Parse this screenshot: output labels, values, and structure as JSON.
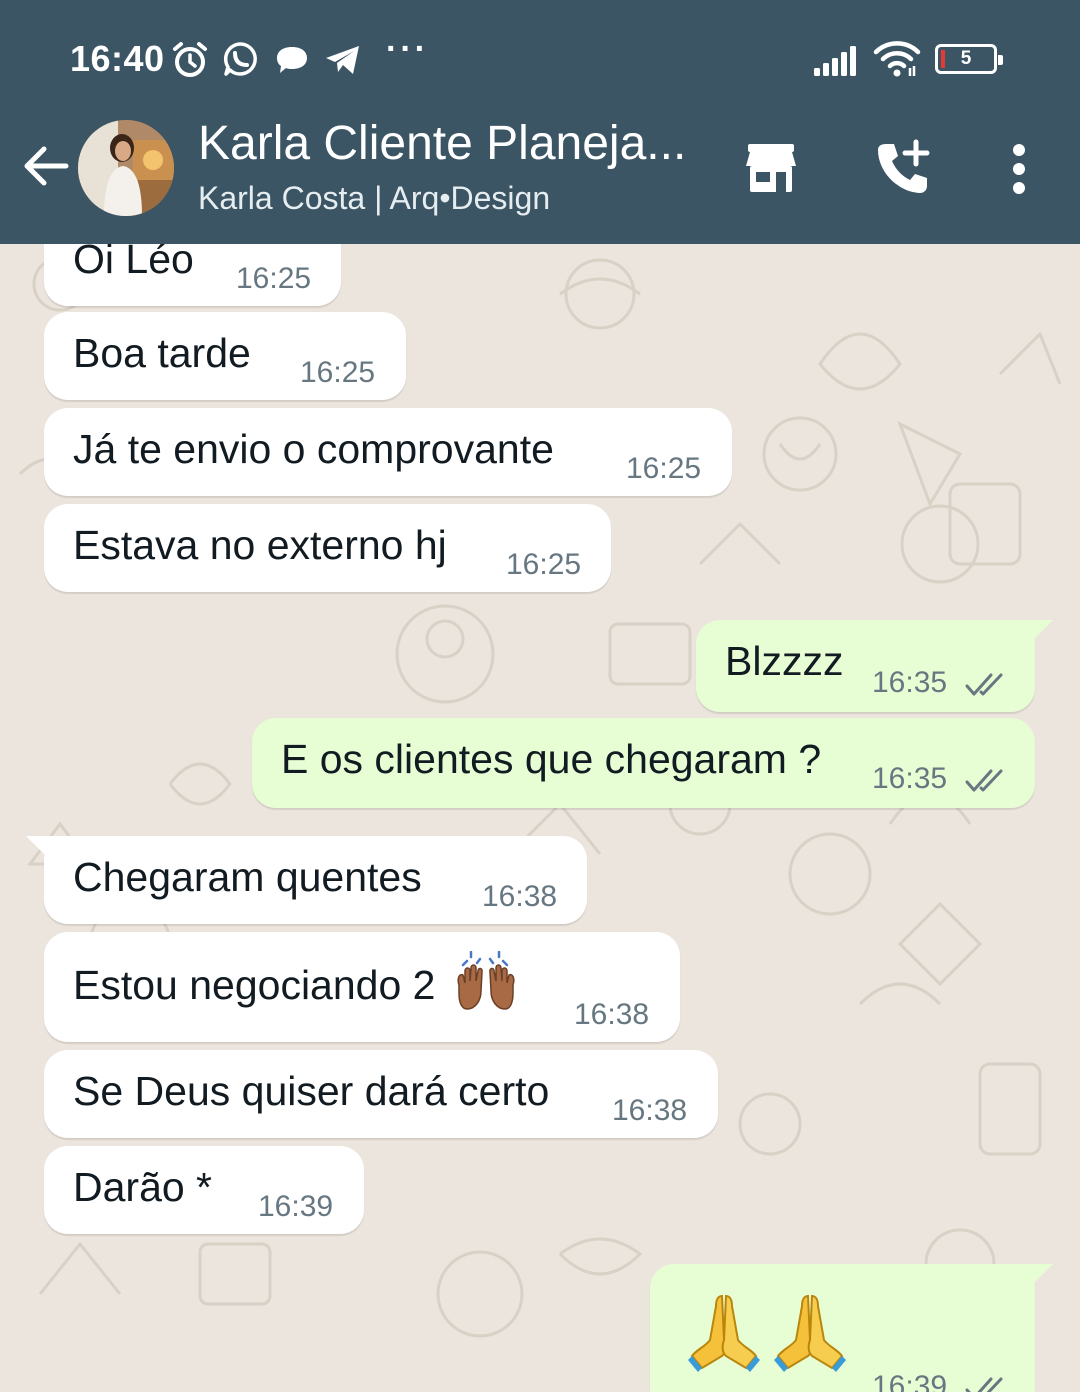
{
  "status_bar": {
    "time": "16:40",
    "battery": "5",
    "icons": [
      "alarm-icon",
      "whatsapp-icon",
      "chat-bubble-icon",
      "telegram-icon",
      "more-dots-icon",
      "signal-icon",
      "wifi-icon",
      "battery-icon"
    ],
    "overflow": "···"
  },
  "header": {
    "title": "Karla Cliente Planeja...",
    "subtitle": "Karla Costa | Arq•Design",
    "actions": [
      "store-icon",
      "add-call-icon",
      "more-vert-icon"
    ]
  },
  "colors": {
    "header_bg": "#3b5565",
    "chat_bg": "#ece5dd",
    "incoming_bubble": "#ffffff",
    "outgoing_bubble": "#e7fdd4",
    "timestamp": "#667781",
    "read_ticks": "#667781"
  },
  "messages": [
    {
      "direction": "in",
      "text": "Oi Léo",
      "time": "16:25"
    },
    {
      "direction": "in",
      "text": "Boa tarde",
      "time": "16:25"
    },
    {
      "direction": "in",
      "text": "Já te envio o comprovante",
      "time": "16:25"
    },
    {
      "direction": "in",
      "text": "Estava no externo hj",
      "time": "16:25"
    },
    {
      "direction": "out",
      "text": "Blzzzz",
      "time": "16:35",
      "status": "read"
    },
    {
      "direction": "out",
      "text": "E os clientes que chegaram ?",
      "time": "16:35",
      "status": "read"
    },
    {
      "direction": "in",
      "text": "Chegaram quentes",
      "time": "16:38"
    },
    {
      "direction": "in",
      "text": "Estou negociando 2",
      "emoji": "raising-hands-emoji",
      "time": "16:38"
    },
    {
      "direction": "in",
      "text": "Se Deus quiser dará certo",
      "time": "16:38"
    },
    {
      "direction": "in",
      "text": "Darão *",
      "time": "16:39"
    },
    {
      "direction": "out",
      "emoji": "folded-hands-emoji x2",
      "time": "16:39",
      "status": "read"
    }
  ]
}
